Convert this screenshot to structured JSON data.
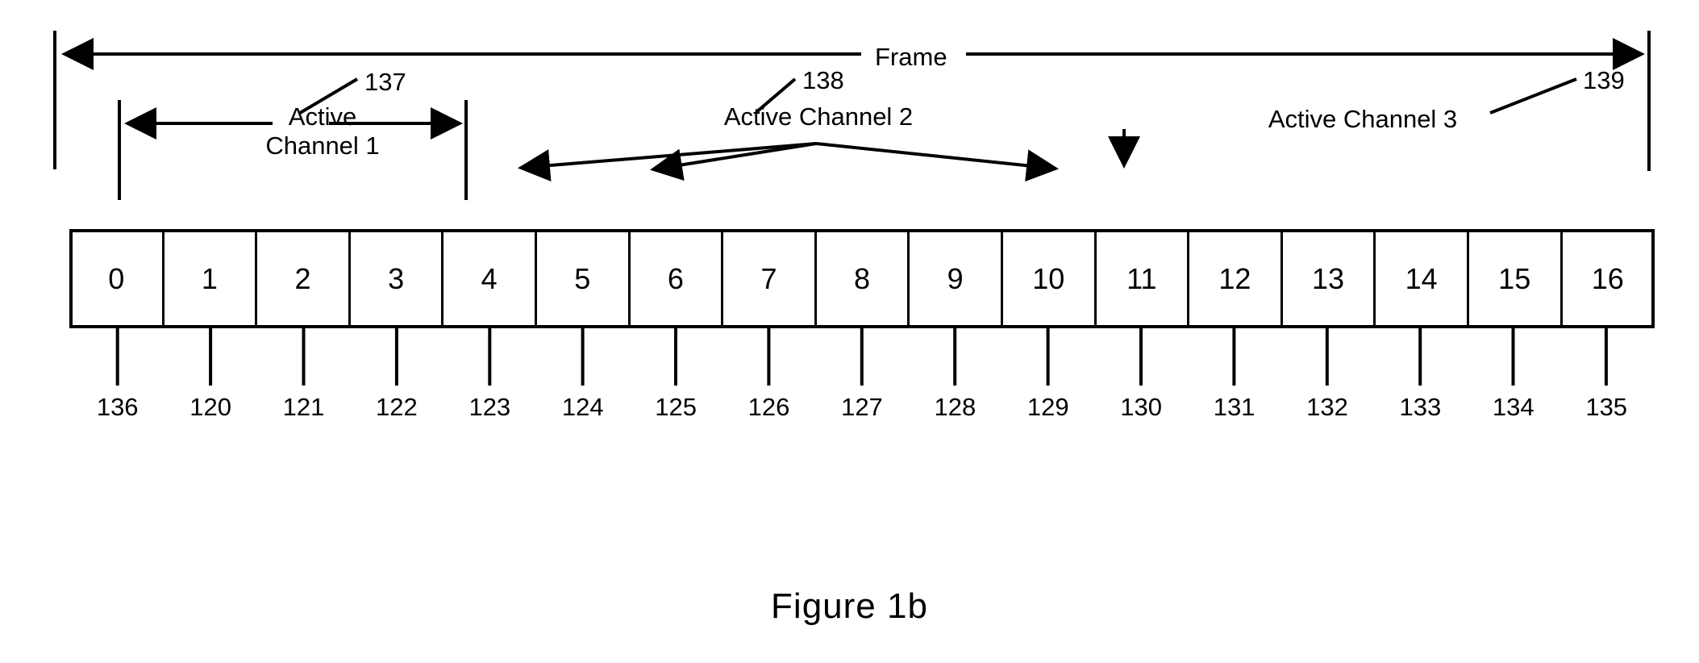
{
  "figure": {
    "caption": "Figure 1b",
    "frame_label": "Frame"
  },
  "channels": [
    {
      "id": "active-channel-1",
      "label": "Active\nChannel 1",
      "label_line1": "Active",
      "label_line2": "Channel 1",
      "ref": "137"
    },
    {
      "id": "active-channel-2",
      "label": "Active Channel 2",
      "ref": "138"
    },
    {
      "id": "active-channel-3",
      "label": "Active Channel 3",
      "ref": "139"
    }
  ],
  "refs": {
    "ref_137": "137",
    "ref_138": "138",
    "ref_139": "139"
  },
  "slots": [
    {
      "index": "0",
      "tick": "136"
    },
    {
      "index": "1",
      "tick": "120"
    },
    {
      "index": "2",
      "tick": "121"
    },
    {
      "index": "3",
      "tick": "122"
    },
    {
      "index": "4",
      "tick": "123"
    },
    {
      "index": "5",
      "tick": "124"
    },
    {
      "index": "6",
      "tick": "125"
    },
    {
      "index": "7",
      "tick": "126"
    },
    {
      "index": "8",
      "tick": "127"
    },
    {
      "index": "9",
      "tick": "128"
    },
    {
      "index": "10",
      "tick": "129"
    },
    {
      "index": "11",
      "tick": "130"
    },
    {
      "index": "12",
      "tick": "131"
    },
    {
      "index": "13",
      "tick": "132"
    },
    {
      "index": "14",
      "tick": "133"
    },
    {
      "index": "15",
      "tick": "134"
    },
    {
      "index": "16",
      "tick": "135"
    }
  ],
  "chart_data": {
    "type": "table",
    "title": "Figure 1b",
    "xlabel": "",
    "ylabel": "",
    "categories": [
      "0",
      "1",
      "2",
      "3",
      "4",
      "5",
      "6",
      "7",
      "8",
      "9",
      "10",
      "11",
      "12",
      "13",
      "14",
      "15",
      "16"
    ],
    "values": [
      136,
      120,
      121,
      122,
      123,
      124,
      125,
      126,
      127,
      128,
      129,
      130,
      131,
      132,
      133,
      134,
      135
    ],
    "annotations": [
      {
        "text": "Frame",
        "ref": "",
        "span": "0-16"
      },
      {
        "text": "Active Channel 1",
        "ref": "137",
        "span": "1-5"
      },
      {
        "text": "Active Channel 2",
        "ref": "138",
        "points_to": [
          "6",
          "8",
          "14"
        ]
      },
      {
        "text": "Active Channel 3",
        "ref": "139",
        "points_to": [
          "15"
        ]
      }
    ],
    "grid": false,
    "legend": "none"
  },
  "colors": {
    "ink": "#000000",
    "paper": "#ffffff"
  }
}
